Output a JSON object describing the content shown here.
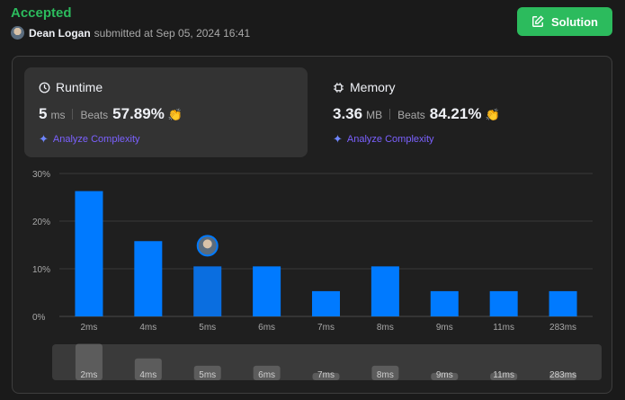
{
  "header": {
    "status": "Accepted",
    "username": "Dean Logan",
    "submitted_text": "submitted at Sep 05, 2024 16:41"
  },
  "solution_button": {
    "label": "Solution",
    "icon": "pencil-square-icon"
  },
  "runtime": {
    "title": "Runtime",
    "value": "5",
    "unit": "ms",
    "beats_label": "Beats",
    "beats_pct": "57.89%",
    "analyze": "Analyze Complexity"
  },
  "memory": {
    "title": "Memory",
    "value": "3.36",
    "unit": "MB",
    "beats_label": "Beats",
    "beats_pct": "84.21%",
    "analyze": "Analyze Complexity"
  },
  "colors": {
    "accent_green": "#2cbb5d",
    "bar": "#007aff",
    "bar_selected": "#0a6ee0",
    "analyze": "#7b61ff"
  },
  "chart_data": {
    "type": "bar",
    "categories": [
      "2ms",
      "4ms",
      "5ms",
      "6ms",
      "7ms",
      "8ms",
      "9ms",
      "11ms",
      "283ms"
    ],
    "values": [
      26.3,
      15.8,
      10.5,
      10.5,
      5.3,
      10.5,
      5.3,
      5.3,
      5.3
    ],
    "yticks": [
      "0%",
      "10%",
      "20%",
      "30%"
    ],
    "ylim": [
      0,
      30
    ],
    "grid": true,
    "highlight_category": "5ms",
    "title": "",
    "xlabel": "",
    "ylabel": ""
  }
}
